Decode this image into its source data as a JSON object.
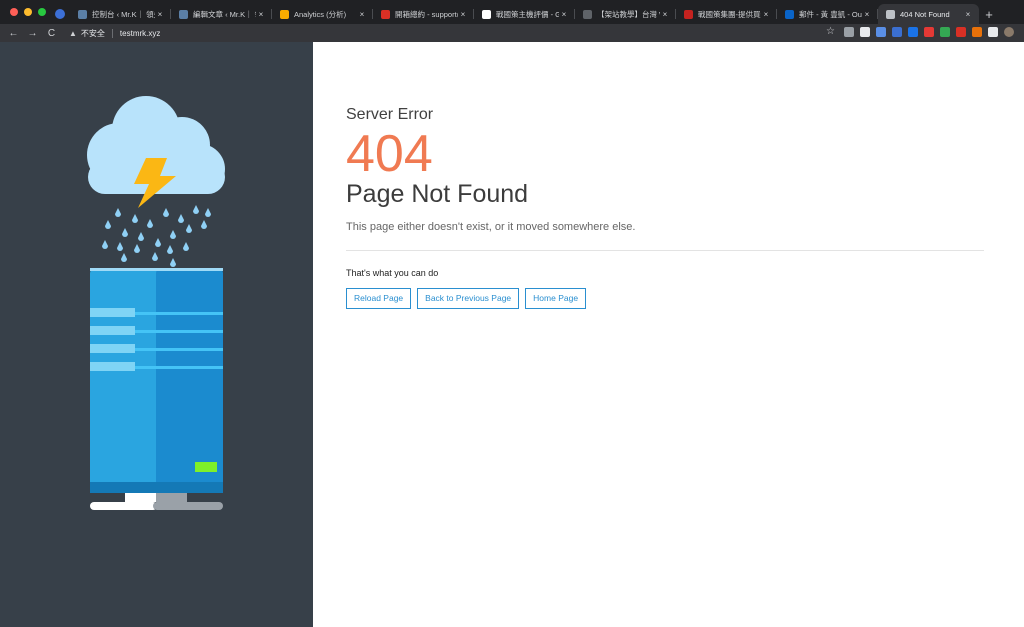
{
  "browser": {
    "tabs": [
      {
        "title": "控制台 ‹ Mr.K｜ 領先",
        "favicon_color": "#5b7fa6",
        "active": false
      },
      {
        "title": "編輯文章 ‹ Mr.K｜ 領",
        "favicon_color": "#5b7fa6",
        "active": false
      },
      {
        "title": "Analytics (分析)",
        "favicon_color": "#f9ab00",
        "active": false
      },
      {
        "title": "開箱總約 - support@",
        "favicon_color": "#d93025",
        "active": false
      },
      {
        "title": "戰國策主機評價 - Goo",
        "favicon_color": "#ffffff",
        "active": false
      },
      {
        "title": "【架站教學】台灣 Wo",
        "favicon_color": "#5f6368",
        "active": false
      },
      {
        "title": "戰國策集團-提供買網",
        "favicon_color": "#c5221f",
        "active": false
      },
      {
        "title": "郵件 - 黃 豊凱 - Outlo",
        "favicon_color": "#0a64c8",
        "active": false
      },
      {
        "title": "404 Not Found",
        "favicon_color": "#bdc1c6",
        "active": true
      }
    ],
    "close_glyph": "×",
    "new_tab_glyph": "+",
    "nav": {
      "back": "←",
      "forward": "→",
      "reload": "C"
    },
    "security_label": "不安全",
    "url": "testmrk.xyz",
    "bookmark_glyph": "☆",
    "extension_colors": [
      "#9aa0a6",
      "#e8eaed",
      "#5a8fe6",
      "#3b6fd0",
      "#1a73e8",
      "#e53935",
      "#34a853",
      "#d93025",
      "#e8710a",
      "#e8eaed"
    ]
  },
  "illustration": {
    "panel_color": "#374049",
    "cloud_color": "#b8e3fb",
    "bolt_color": "#fbb714",
    "rain_color": "#8fd0f5",
    "server_color": "#2aa5e0",
    "server_shade": "#1b8bcf",
    "status_led_color": "#7ef02a"
  },
  "error": {
    "subtitle": "Server Error",
    "code": "404",
    "title": "Page Not Found",
    "description": "This page either doesn't exist, or it moved somewhere else.",
    "actions_label": "That's what you can do",
    "buttons": [
      "Reload Page",
      "Back to Previous Page",
      "Home Page"
    ],
    "accent_color": "#f07a52",
    "link_color": "#2a8fd0"
  }
}
